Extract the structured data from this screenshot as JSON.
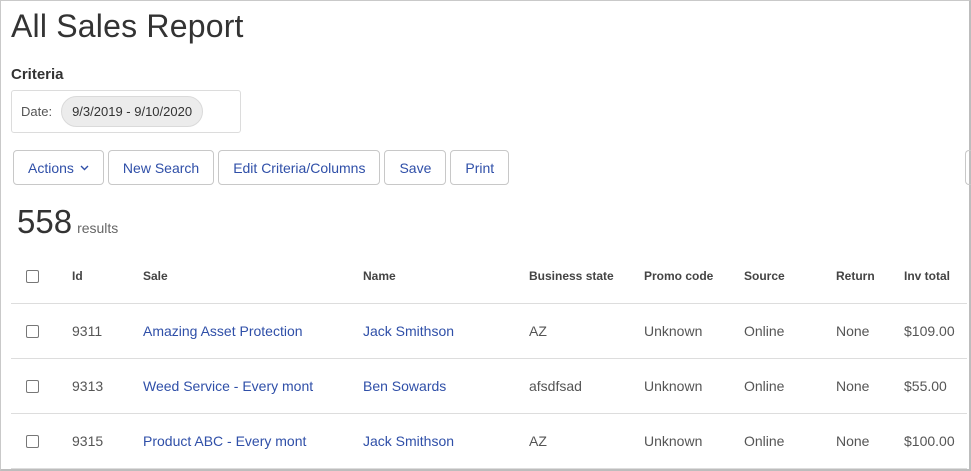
{
  "page": {
    "title": "All Sales Report"
  },
  "criteria": {
    "heading": "Criteria",
    "date_label": "Date:",
    "date_value": "9/3/2019 - 9/10/2020"
  },
  "toolbar": {
    "actions": "Actions",
    "new_search": "New Search",
    "edit_criteria": "Edit Criteria/Columns",
    "save": "Save",
    "print": "Print"
  },
  "results": {
    "count": "558",
    "label": "results"
  },
  "table": {
    "headers": [
      "Id",
      "Sale",
      "Name",
      "Business state",
      "Promo code",
      "Source",
      "Return",
      "Inv total"
    ],
    "rows": [
      {
        "id": "9311",
        "sale": "Amazing Asset Protection",
        "name": "Jack Smithson",
        "state": "AZ",
        "promo": "Unknown",
        "source": "Online",
        "return": "None",
        "total": "$109.00"
      },
      {
        "id": "9313",
        "sale": "Weed Service - Every mont",
        "name": "Ben Sowards",
        "state": "afsdfsad",
        "promo": "Unknown",
        "source": "Online",
        "return": "None",
        "total": "$55.00"
      },
      {
        "id": "9315",
        "sale": "Product ABC - Every mont",
        "name": "Jack Smithson",
        "state": "AZ",
        "promo": "Unknown",
        "source": "Online",
        "return": "None",
        "total": "$100.00"
      }
    ]
  },
  "colors": {
    "link": "#2f4fa8",
    "text": "#333333",
    "border": "#dddddd"
  },
  "icons": {
    "actions_dropdown": "chevron-down-icon"
  }
}
